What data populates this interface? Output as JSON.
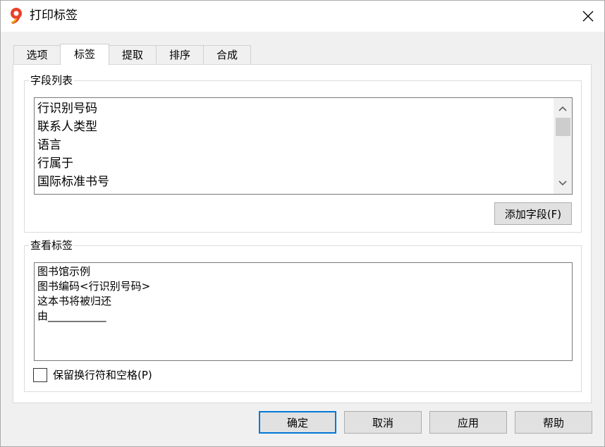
{
  "window": {
    "title": "打印标签",
    "app_icon": "app-9-icon",
    "close_icon": "close-icon"
  },
  "tabs": [
    {
      "label": "选项",
      "active": false
    },
    {
      "label": "标签",
      "active": true
    },
    {
      "label": "提取",
      "active": false
    },
    {
      "label": "排序",
      "active": false
    },
    {
      "label": "合成",
      "active": false
    }
  ],
  "fields_group": {
    "label": "字段列表",
    "items": [
      "行识别号码",
      "联系人类型",
      "语言",
      "行属于",
      "国际标准书号"
    ],
    "add_button": "添加字段(F)"
  },
  "view_group": {
    "label": "查看标签",
    "lines": [
      "图书馆示例",
      "图书编码<行识别号码>",
      "这本书将被归还",
      "由___________"
    ],
    "keep_linebreaks_label": "保留换行符和空格(P)",
    "keep_linebreaks_checked": false
  },
  "footer": {
    "ok": "确定",
    "cancel": "取消",
    "apply": "应用",
    "help": "帮助"
  }
}
